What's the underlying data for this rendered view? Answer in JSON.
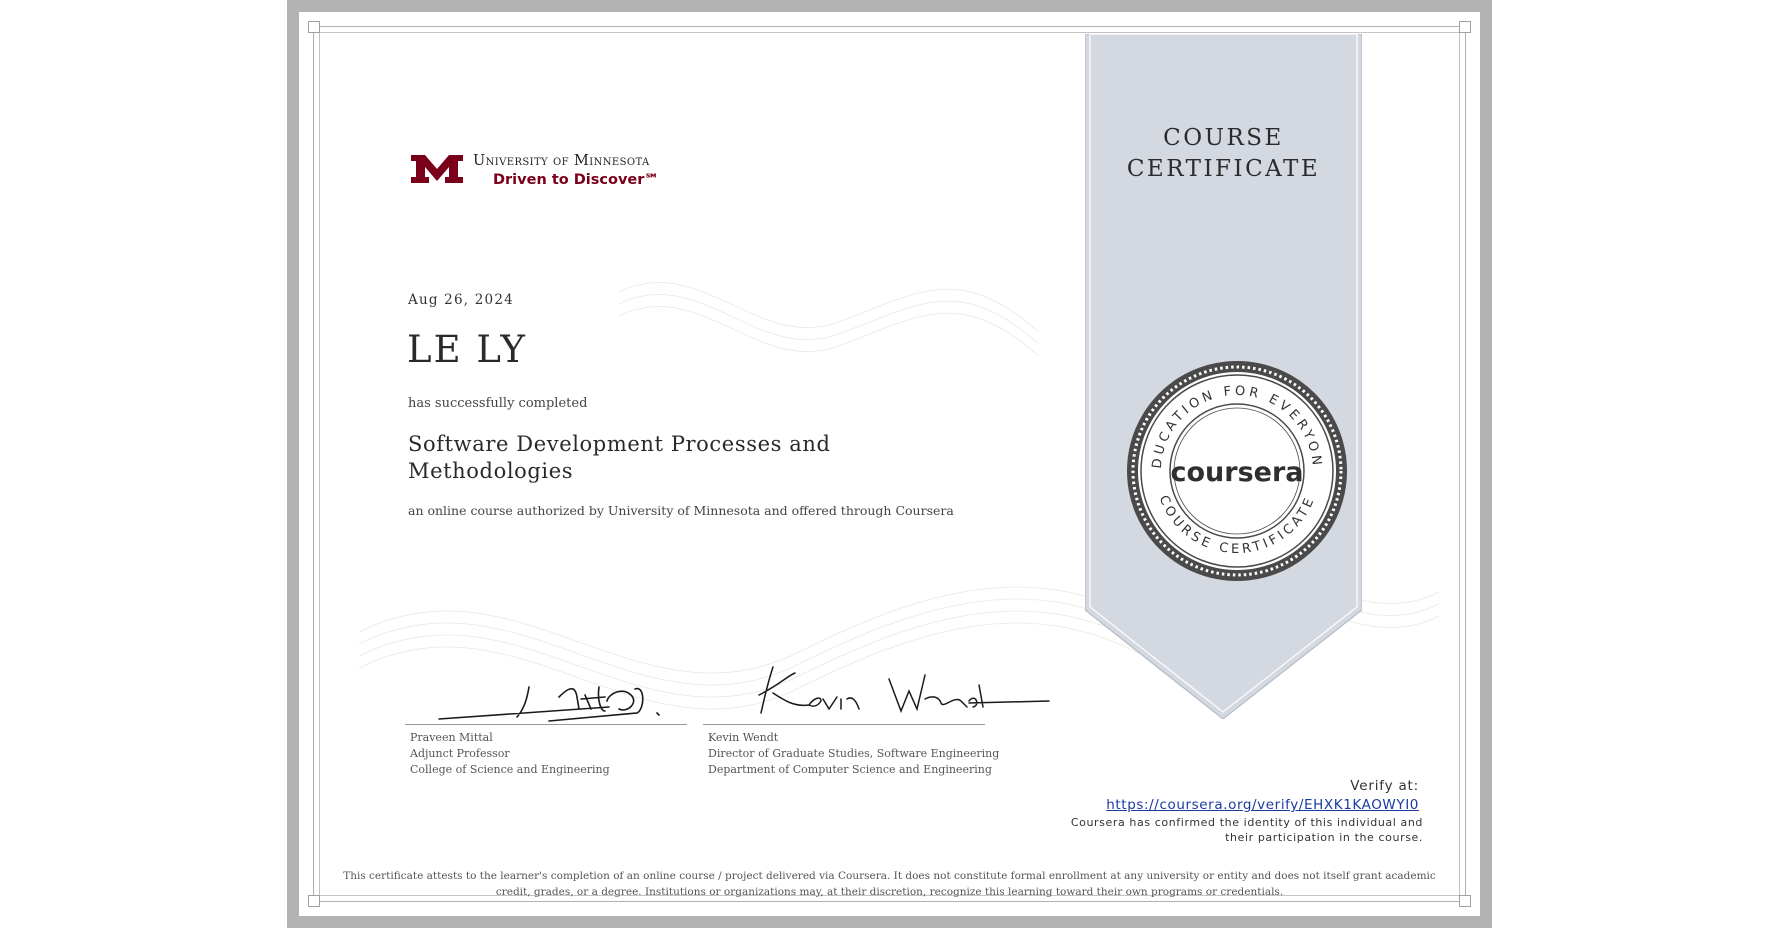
{
  "university_logo": {
    "name": "University of Minnesota",
    "tagline": "Driven to Discover℠",
    "color": "#7a0019"
  },
  "ribbon": {
    "title_line1": "COURSE",
    "title_line2": "CERTIFICATE"
  },
  "seal": {
    "top_text": "EDUCATION FOR EVERYONE",
    "bottom_text": "COURSE CERTIFICATE",
    "brand": "coursera"
  },
  "certificate": {
    "date": "Aug 26, 2024",
    "recipient": "LE LY",
    "completed_text": "has successfully completed",
    "course_title": "Software Development Processes and Methodologies",
    "authorization": "an online course authorized by University of Minnesota and offered through Coursera"
  },
  "signatories": [
    {
      "name": "Praveen Mittal",
      "title": "Adjunct Professor",
      "department": "College of Science and Engineering"
    },
    {
      "name": "Kevin Wendt",
      "title": "Director of Graduate Studies, Software Engineering",
      "department": "Department of Computer Science and Engineering"
    }
  ],
  "verification": {
    "label": "Verify at:",
    "url": "https://coursera.org/verify/EHXK1KAOWYI0",
    "confirmation": "Coursera has confirmed the identity of this individual and their participation in the course."
  },
  "disclaimer": "This certificate attests to the learner's completion of an online course / project delivered via Coursera. It does not constitute formal enrollment at any university or entity and does not itself grant academic credit, grades, or a degree. Institutions or organizations may, at their discretion, recognize this learning toward their own programs or credentials."
}
